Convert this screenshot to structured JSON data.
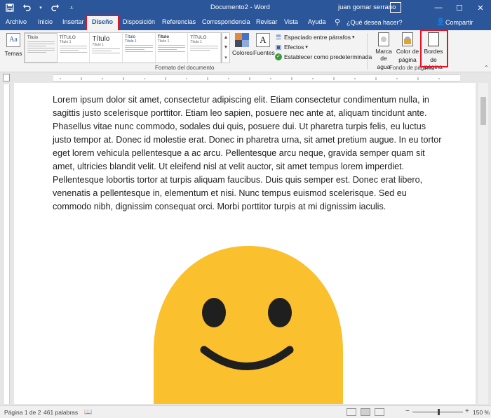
{
  "app": {
    "title": "Documento2 - Word",
    "user": "juan gomar serrano"
  },
  "qat": {
    "save_icon": "save-icon",
    "undo_icon": "undo-icon",
    "redo_icon": "redo-icon",
    "customize_icon": "chevron-down-icon"
  },
  "window_buttons": {
    "minimize": "—",
    "maximize": "☐",
    "close": "✕"
  },
  "tabs": [
    {
      "label": "Archivo"
    },
    {
      "label": "Inicio"
    },
    {
      "label": "Insertar"
    },
    {
      "label": "Diseño",
      "active": true
    },
    {
      "label": "Disposición"
    },
    {
      "label": "Referencias"
    },
    {
      "label": "Correspondencia"
    },
    {
      "label": "Revisar"
    },
    {
      "label": "Vista"
    },
    {
      "label": "Ayuda"
    }
  ],
  "tellme": "¿Qué desea hacer?",
  "share": "Compartir",
  "ribbon": {
    "themes_label": "Temas",
    "gallery": [
      {
        "title": "Título",
        "sub": ""
      },
      {
        "title": "TÍTULO",
        "sub": "Título 1"
      },
      {
        "title": "Título",
        "sub": "Título 1"
      },
      {
        "title": "Título",
        "sub": "Título 1"
      },
      {
        "title": "Título",
        "sub": "Título 1"
      },
      {
        "title": "TÍTULO",
        "sub": "Título 1"
      }
    ],
    "colors_label": "Colores",
    "fonts_label": "Fuentes",
    "paragraph_spacing": "Espaciado entre párrafos",
    "effects": "Efectos",
    "set_default": "Establecer como predeterminada",
    "doc_format_label": "Formato del documento",
    "watermark_l1": "Marca de",
    "watermark_l2": "agua",
    "page_color_l1": "Color de",
    "page_color_l2": "página",
    "page_borders_l1": "Bordes",
    "page_borders_l2": "de página",
    "page_background_label": "Fondo de página"
  },
  "document": {
    "paragraph": "Lorem ipsum dolor sit amet, consectetur adipiscing elit. Etiam consectetur condimentum nulla, in sagittis justo scelerisque porttitor. Etiam leo sapien, posuere nec ante at, aliquam tincidunt ante. Phasellus vitae nunc commodo, sodales dui quis, posuere dui. Ut pharetra turpis felis, eu luctus justo tempor at. Donec id molestie erat. Donec in pharetra urna, sit amet pretium augue. In eu tortor eget lorem vehicula pellentesque a ac arcu. Pellentesque arcu neque, gravida semper quam sit amet, ultricies blandit velit. Ut eleifend nisl at velit auctor, sit amet tempus lorem imperdiet. Pellentesque lobortis tortor at turpis aliquam faucibus. Duis quis semper est. Donec erat libero, venenatis a pellentesque in, elementum et nisi. Nunc tempus euismod scelerisque. Sed eu commodo nibh, dignissim consequat orci. Morbi porttitor turpis at mi dignissim iaculis.",
    "emoji_color": "#fbc02d"
  },
  "status": {
    "page": "Página 1 de 2",
    "words": "461 palabras",
    "zoom_minus": "−",
    "zoom_plus": "+",
    "zoom": "150 %"
  },
  "colors": {
    "accent": "#2b579a",
    "highlight": "#e81123"
  }
}
